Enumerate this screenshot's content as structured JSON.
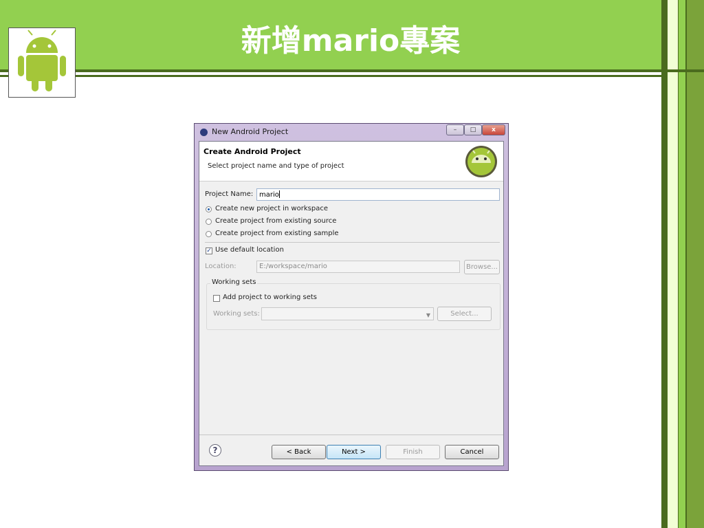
{
  "slide": {
    "title": "新增mario專案",
    "colors": {
      "banner": "#92d050",
      "dark_green": "#4a6b1e",
      "light_green": "#f2ffd6"
    }
  },
  "dialog": {
    "window_title": "New Android Project",
    "window_buttons": {
      "minimize": "–",
      "maximize": "□",
      "close": "x"
    },
    "header": {
      "title": "Create Android Project",
      "subtitle": "Select project name and type of project"
    },
    "project_name": {
      "label": "Project Name:",
      "value": "mario"
    },
    "source_options": [
      {
        "label": "Create new project in workspace",
        "selected": true
      },
      {
        "label": "Create project from existing source",
        "selected": false
      },
      {
        "label": "Create project from existing sample",
        "selected": false
      }
    ],
    "use_default_location": {
      "label": "Use default location",
      "checked": true
    },
    "location": {
      "label": "Location:",
      "value": "E:/workspace/mario",
      "browse_label": "Browse..."
    },
    "working_sets": {
      "group_label": "Working sets",
      "add_label": "Add project to working sets",
      "add_checked": false,
      "sets_label": "Working sets:",
      "sets_value": "",
      "select_label": "Select..."
    },
    "footer": {
      "back_label": "< Back",
      "next_label": "Next >",
      "finish_label": "Finish",
      "cancel_label": "Cancel"
    }
  }
}
